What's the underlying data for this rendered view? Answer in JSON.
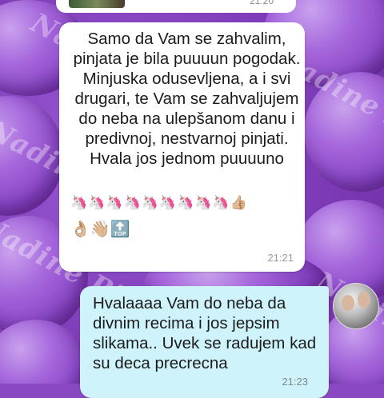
{
  "chat": {
    "top_time": "21:20",
    "watermark": "Nadine Pinjate",
    "messages": [
      {
        "direction": "incoming",
        "text": "Samo da Vam se zahvalim, pinjata je bila puuuun pogodak. Minjuska odusevljena, a i svi drugari, te Vam se zahvaljujem do neba na ulepšanom danu i predivnoj, nestvarnoj pinjati. Hvala jos jednom puuuuno",
        "emoji_line1": "🦄🦄🦄🦄🦄🦄🦄🦄🦄👍🏼",
        "emoji_line2": "👌🏼👋🏼🔝",
        "time": "21:21"
      },
      {
        "direction": "outgoing",
        "text": "Hvalaaaa Vam do neba da divnim recima i jos jepsim slikama.. Uvek se radujem kad su deca precrecna",
        "time": "21:23"
      }
    ],
    "avatar_icon": "couple-photo-avatar"
  },
  "colors": {
    "incoming_bubble": "#ffffff",
    "outgoing_bubble": "#cff3fb",
    "background": "#8a48c2"
  }
}
